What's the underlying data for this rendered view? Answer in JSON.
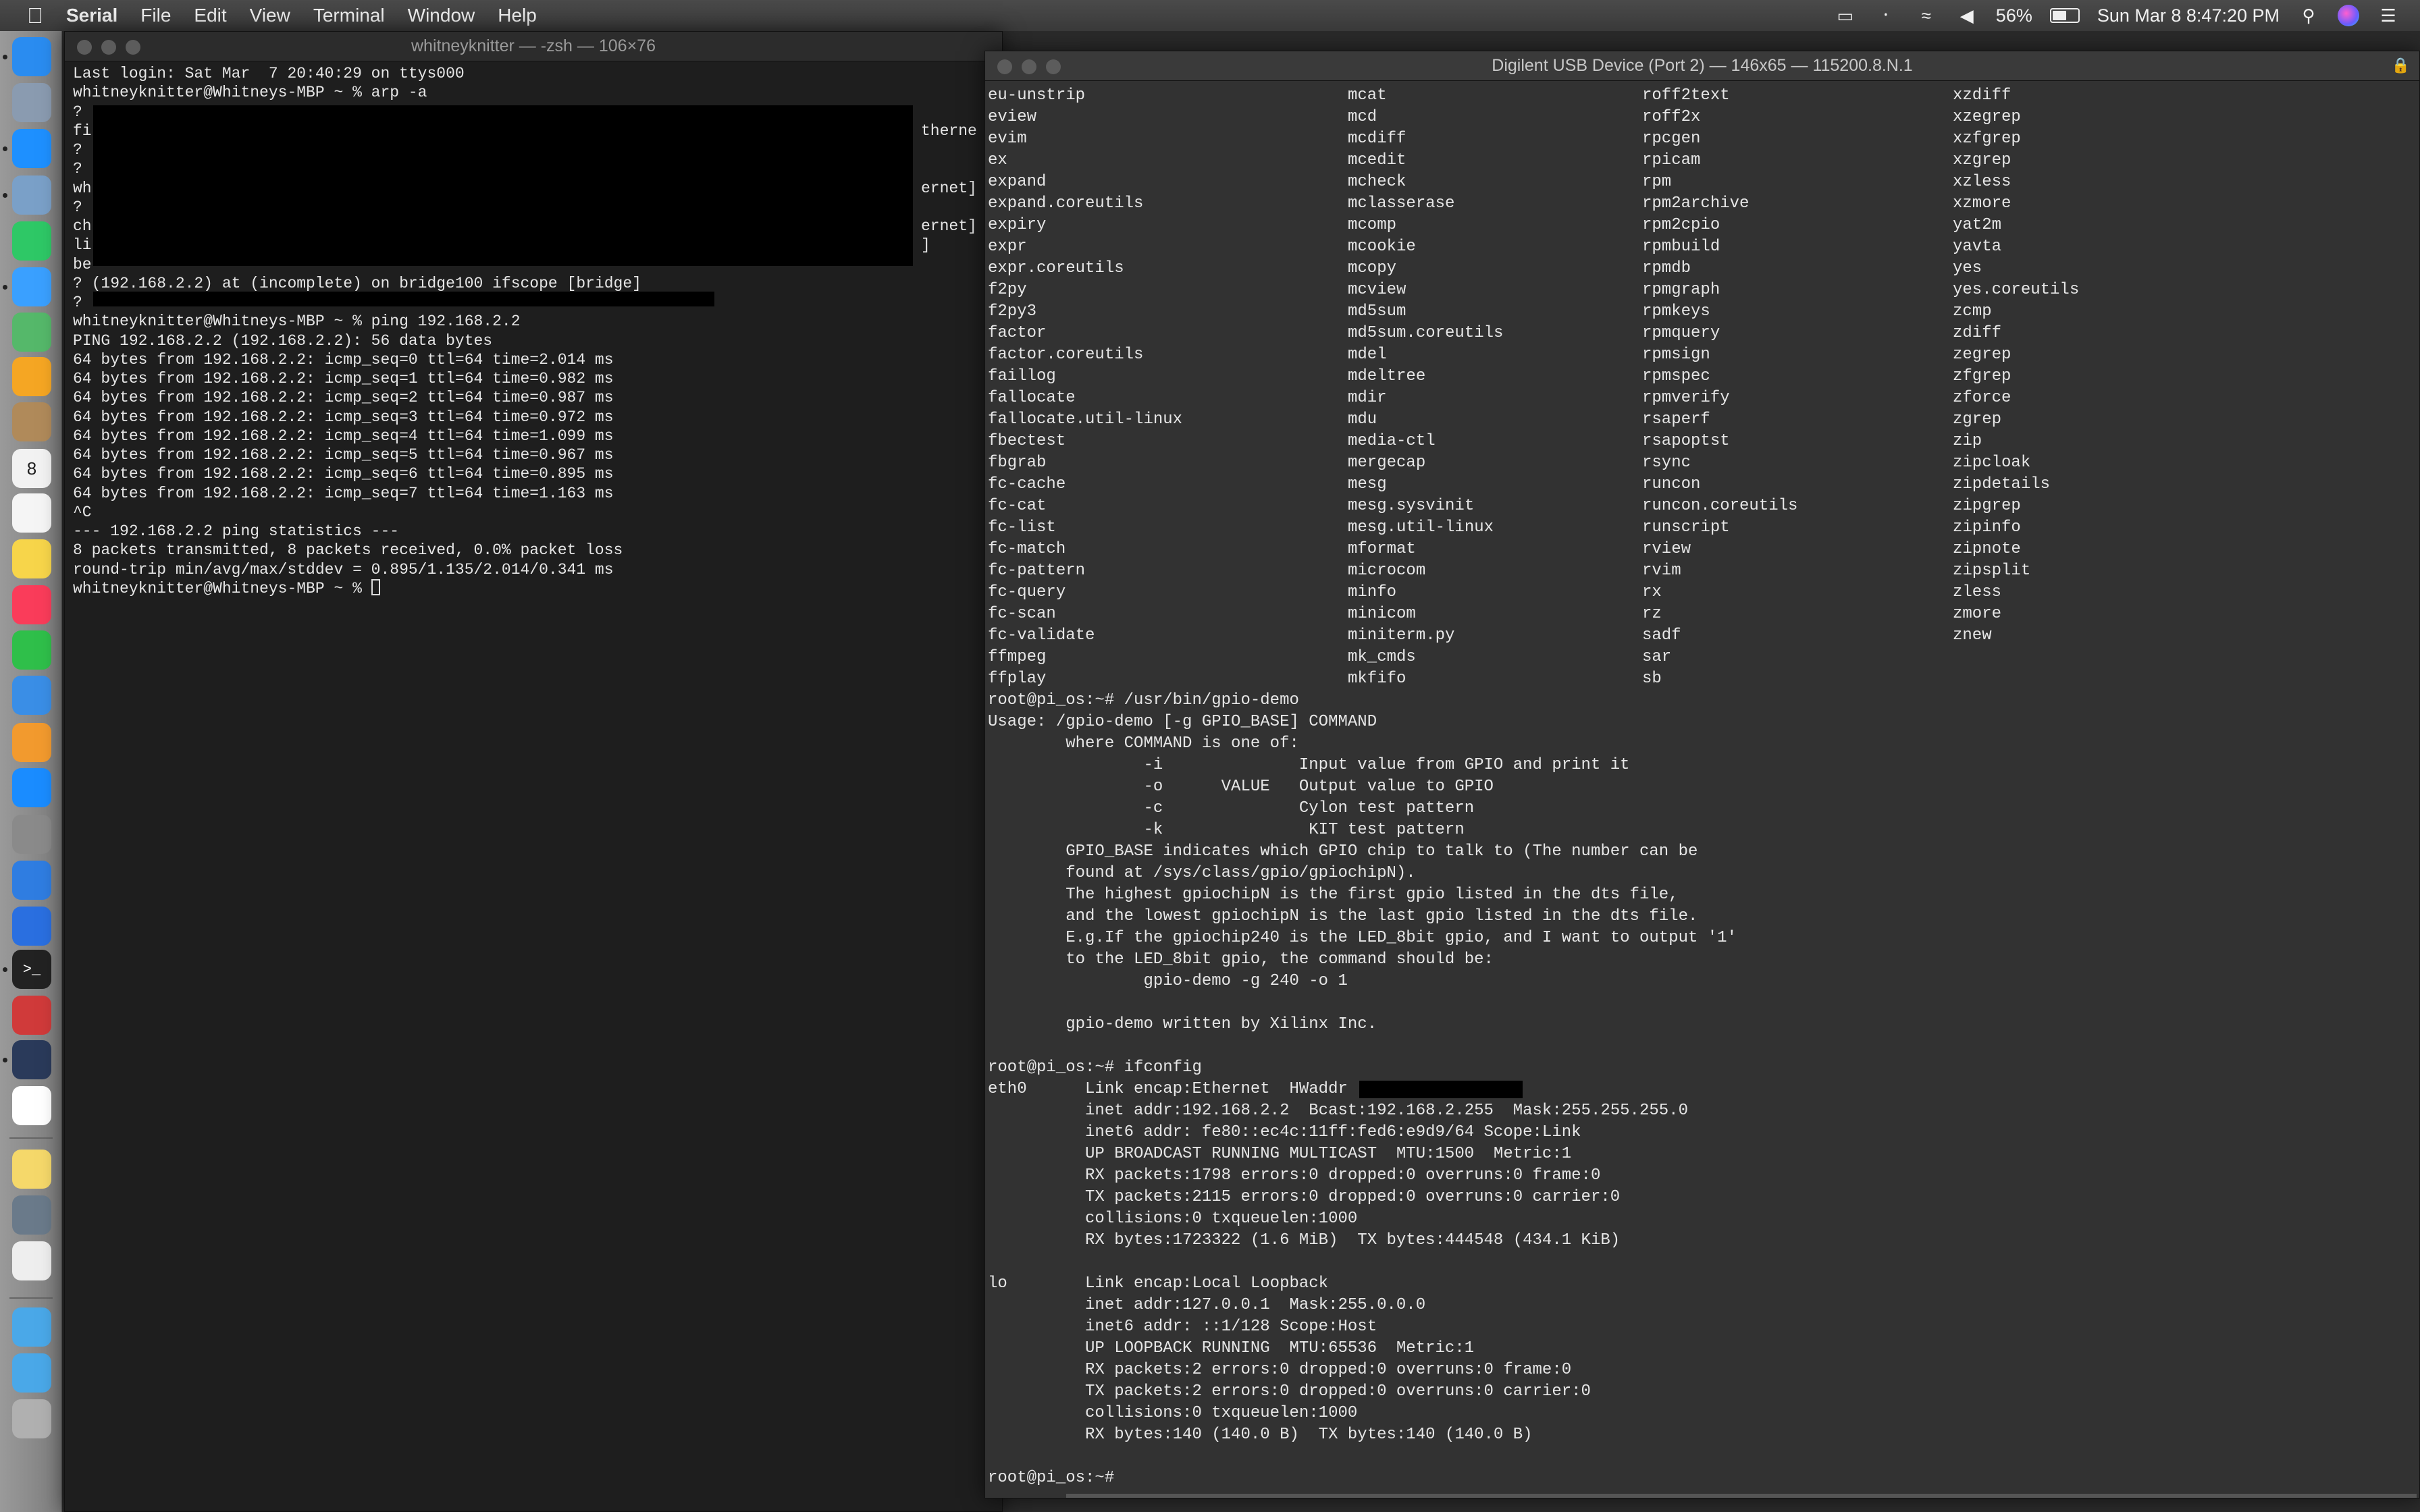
{
  "menubar": {
    "app": "Serial",
    "items": [
      "File",
      "Edit",
      "View",
      "Terminal",
      "Window",
      "Help"
    ],
    "status": {
      "battery_percent": "56%",
      "battery_level": 0.56,
      "clock": "Sun Mar 8  8:47:20 PM",
      "icons": [
        "airplay-icon",
        "bluetooth-icon",
        "wifi-icon",
        "volume-icon",
        "battery-icon",
        "search-icon",
        "siri-icon",
        "notification-center-icon"
      ]
    }
  },
  "dock": {
    "items": [
      {
        "name": "finder",
        "color": "#2a8cf0"
      },
      {
        "name": "launchpad",
        "color": "#8a9bb0"
      },
      {
        "name": "safari",
        "color": "#1e90ff"
      },
      {
        "name": "preview",
        "color": "#7aa0c8"
      },
      {
        "name": "facetime",
        "color": "#2ec866"
      },
      {
        "name": "messages",
        "color": "#3aa0ff"
      },
      {
        "name": "maps",
        "color": "#55b86a"
      },
      {
        "name": "photos",
        "color": "#f5a623"
      },
      {
        "name": "contacts",
        "color": "#b08a5a"
      },
      {
        "name": "calendar",
        "color": "#f2f2f2"
      },
      {
        "name": "reminders",
        "color": "#f5f5f5"
      },
      {
        "name": "notes",
        "color": "#f7d54a"
      },
      {
        "name": "music",
        "color": "#fa3c5a"
      },
      {
        "name": "numbers",
        "color": "#2fbf4a"
      },
      {
        "name": "keynote",
        "color": "#3a8ee6"
      },
      {
        "name": "pages",
        "color": "#f29a2e"
      },
      {
        "name": "app-store",
        "color": "#1a8cff"
      },
      {
        "name": "system-preferences",
        "color": "#8a8a8a"
      },
      {
        "name": "xcode",
        "color": "#2f7de1"
      },
      {
        "name": "pixelmator",
        "color": "#2a6fe0"
      },
      {
        "name": "terminal",
        "color": "#222222"
      },
      {
        "name": "parallels",
        "color": "#d03a3a"
      },
      {
        "name": "serial",
        "color": "#2a3a5a"
      },
      {
        "name": "slack",
        "color": "#ffffff"
      },
      {
        "name": "stickies",
        "color": "#f5d86a"
      },
      {
        "name": "photo-booth",
        "color": "#6a7a8a"
      },
      {
        "name": "textedit",
        "color": "#eeeeee"
      },
      {
        "name": "applications-folder",
        "color": "#4aa8e8"
      },
      {
        "name": "downloads-folder",
        "color": "#4aa8e8"
      },
      {
        "name": "trash",
        "color": "#b0b0b0"
      }
    ],
    "calendar_day": "8"
  },
  "left_window": {
    "title": "whitneyknitter — -zsh — 106×76",
    "lines": [
      {
        "text": "Last login: Sat Mar  7 20:40:29 on ttys000"
      },
      {
        "text": "whitneyknitter@Whitneys-MBP ~ % arp -a"
      },
      {
        "text": "?"
      },
      {
        "text": "fi",
        "right": "therne"
      },
      {
        "text": "?"
      },
      {
        "text": "?"
      },
      {
        "text": "wh",
        "right": "ernet]"
      },
      {
        "text": "?"
      },
      {
        "text": "ch",
        "right": "ernet]"
      },
      {
        "text": "li",
        "right": "]"
      },
      {
        "text": "be"
      },
      {
        "text": "? (192.168.2.2) at (incomplete) on bridge100 ifscope [bridge]"
      },
      {
        "text": "?"
      },
      {
        "text": "whitneyknitter@Whitneys-MBP ~ % ping 192.168.2.2"
      },
      {
        "text": "PING 192.168.2.2 (192.168.2.2): 56 data bytes"
      },
      {
        "text": "64 bytes from 192.168.2.2: icmp_seq=0 ttl=64 time=2.014 ms"
      },
      {
        "text": "64 bytes from 192.168.2.2: icmp_seq=1 ttl=64 time=0.982 ms"
      },
      {
        "text": "64 bytes from 192.168.2.2: icmp_seq=2 ttl=64 time=0.987 ms"
      },
      {
        "text": "64 bytes from 192.168.2.2: icmp_seq=3 ttl=64 time=0.972 ms"
      },
      {
        "text": "64 bytes from 192.168.2.2: icmp_seq=4 ttl=64 time=1.099 ms"
      },
      {
        "text": "64 bytes from 192.168.2.2: icmp_seq=5 ttl=64 time=0.967 ms"
      },
      {
        "text": "64 bytes from 192.168.2.2: icmp_seq=6 ttl=64 time=0.895 ms"
      },
      {
        "text": "64 bytes from 192.168.2.2: icmp_seq=7 ttl=64 time=1.163 ms"
      },
      {
        "text": "^C"
      },
      {
        "text": "--- 192.168.2.2 ping statistics ---"
      },
      {
        "text": "8 packets transmitted, 8 packets received, 0.0% packet loss"
      },
      {
        "text": "round-trip min/avg/max/stddev = 0.895/1.135/2.014/0.341 ms"
      },
      {
        "text": "whitneyknitter@Whitneys-MBP ~ % ",
        "cursor": true
      }
    ]
  },
  "right_window": {
    "title": "Digilent USB Device (Port 2) — 146x65 — 115200.8.N.1",
    "columns": [
      [
        "eu-unstrip",
        "eview",
        "evim",
        "ex",
        "expand",
        "expand.coreutils",
        "expiry",
        "expr",
        "expr.coreutils",
        "f2py",
        "f2py3",
        "factor",
        "factor.coreutils",
        "faillog",
        "fallocate",
        "fallocate.util-linux",
        "fbectest",
        "fbgrab",
        "fc-cache",
        "fc-cat",
        "fc-list",
        "fc-match",
        "fc-pattern",
        "fc-query",
        "fc-scan",
        "fc-validate",
        "ffmpeg",
        "ffplay"
      ],
      [
        "mcat",
        "mcd",
        "mcdiff",
        "mcedit",
        "mcheck",
        "mclasserase",
        "mcomp",
        "mcookie",
        "mcopy",
        "mcview",
        "md5sum",
        "md5sum.coreutils",
        "mdel",
        "mdeltree",
        "mdir",
        "mdu",
        "media-ctl",
        "mergecap",
        "mesg",
        "mesg.sysvinit",
        "mesg.util-linux",
        "mformat",
        "microcom",
        "minfo",
        "minicom",
        "miniterm.py",
        "mk_cmds",
        "mkfifo"
      ],
      [
        "roff2text",
        "roff2x",
        "rpcgen",
        "rpicam",
        "rpm",
        "rpm2archive",
        "rpm2cpio",
        "rpmbuild",
        "rpmdb",
        "rpmgraph",
        "rpmkeys",
        "rpmquery",
        "rpmsign",
        "rpmspec",
        "rpmverify",
        "rsaperf",
        "rsapoptst",
        "rsync",
        "runcon",
        "runcon.coreutils",
        "runscript",
        "rview",
        "rvim",
        "rx",
        "rz",
        "sadf",
        "sar",
        "sb"
      ],
      [
        "xzdiff",
        "xzegrep",
        "xzfgrep",
        "xzgrep",
        "xzless",
        "xzmore",
        "yat2m",
        "yavta",
        "yes",
        "yes.coreutils",
        "zcmp",
        "zdiff",
        "zegrep",
        "zfgrep",
        "zforce",
        "zgrep",
        "zip",
        "zipcloak",
        "zipdetails",
        "zipgrep",
        "zipinfo",
        "zipnote",
        "zipsplit",
        "zless",
        "zmore",
        "znew"
      ]
    ],
    "lines": [
      "root@pi_os:~# /usr/bin/gpio-demo",
      "Usage: /gpio-demo [-g GPIO_BASE] COMMAND",
      "        where COMMAND is one of:",
      "                -i              Input value from GPIO and print it",
      "                -o      VALUE   Output value to GPIO",
      "                -c              Cylon test pattern",
      "                -k               KIT test pattern",
      "        GPIO_BASE indicates which GPIO chip to talk to (The number can be",
      "        found at /sys/class/gpio/gpiochipN).",
      "        The highest gpiochipN is the first gpio listed in the dts file,",
      "        and the lowest gpiochipN is the last gpio listed in the dts file.",
      "        E.g.If the gpiochip240 is the LED_8bit gpio, and I want to output '1'",
      "        to the LED_8bit gpio, the command should be:",
      "                gpio-demo -g 240 -o 1",
      "",
      "        gpio-demo written by Xilinx Inc.",
      "",
      "root@pi_os:~# ifconfig",
      "eth0      Link encap:Ethernet  HWaddr (",
      "          inet addr:192.168.2.2  Bcast:192.168.2.255  Mask:255.255.255.0",
      "          inet6 addr: fe80::ec4c:11ff:fed6:e9d9/64 Scope:Link",
      "          UP BROADCAST RUNNING MULTICAST  MTU:1500  Metric:1",
      "          RX packets:1798 errors:0 dropped:0 overruns:0 frame:0",
      "          TX packets:2115 errors:0 dropped:0 overruns:0 carrier:0",
      "          collisions:0 txqueuelen:1000",
      "          RX bytes:1723322 (1.6 MiB)  TX bytes:444548 (434.1 KiB)",
      "",
      "lo        Link encap:Local Loopback",
      "          inet addr:127.0.0.1  Mask:255.0.0.0",
      "          inet6 addr: ::1/128 Scope:Host",
      "          UP LOOPBACK RUNNING  MTU:65536  Metric:1",
      "          RX packets:2 errors:0 dropped:0 overruns:0 frame:0",
      "          TX packets:2 errors:0 dropped:0 overruns:0 carrier:0",
      "          collisions:0 txqueuelen:1000",
      "          RX bytes:140 (140.0 B)  TX bytes:140 (140.0 B)",
      "",
      "root@pi_os:~# "
    ]
  }
}
